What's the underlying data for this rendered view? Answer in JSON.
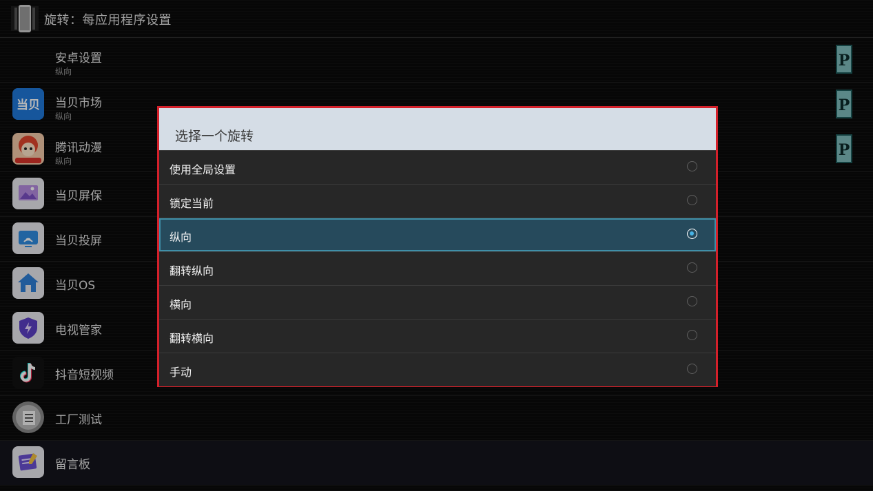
{
  "header": {
    "title": "旋转：每应用程序设置"
  },
  "apps": [
    {
      "name": "安卓设置",
      "subtitle": "纵向",
      "badge": "P",
      "icon": "android-settings-icon"
    },
    {
      "name": "当贝市场",
      "subtitle": "纵向",
      "badge": "P",
      "icon": "dangbei-market-icon",
      "icon_text": "当贝"
    },
    {
      "name": "腾讯动漫",
      "subtitle": "纵向",
      "badge": "P",
      "icon": "tencent-comics-icon"
    },
    {
      "name": "当贝屏保",
      "icon": "screensaver-icon"
    },
    {
      "name": "当贝投屏",
      "icon": "cast-icon"
    },
    {
      "name": "当贝OS",
      "icon": "home-icon"
    },
    {
      "name": "电视管家",
      "icon": "shield-icon"
    },
    {
      "name": "抖音短视频",
      "icon": "tiktok-icon"
    },
    {
      "name": "工厂测试",
      "icon": "factory-test-icon"
    },
    {
      "name": "留言板",
      "icon": "message-board-icon"
    }
  ],
  "dialog": {
    "title": "选择一个旋转",
    "options": [
      {
        "label": "使用全局设置",
        "selected": false
      },
      {
        "label": "锁定当前",
        "selected": false
      },
      {
        "label": "纵向",
        "selected": true
      },
      {
        "label": "翻转纵向",
        "selected": false
      },
      {
        "label": "横向",
        "selected": false
      },
      {
        "label": "翻转横向",
        "selected": false
      },
      {
        "label": "手动",
        "selected": false
      }
    ]
  },
  "colors": {
    "dialog_border": "#d4202a",
    "selected_bg": "#264a5c",
    "radio_dot": "#47b4e6"
  }
}
